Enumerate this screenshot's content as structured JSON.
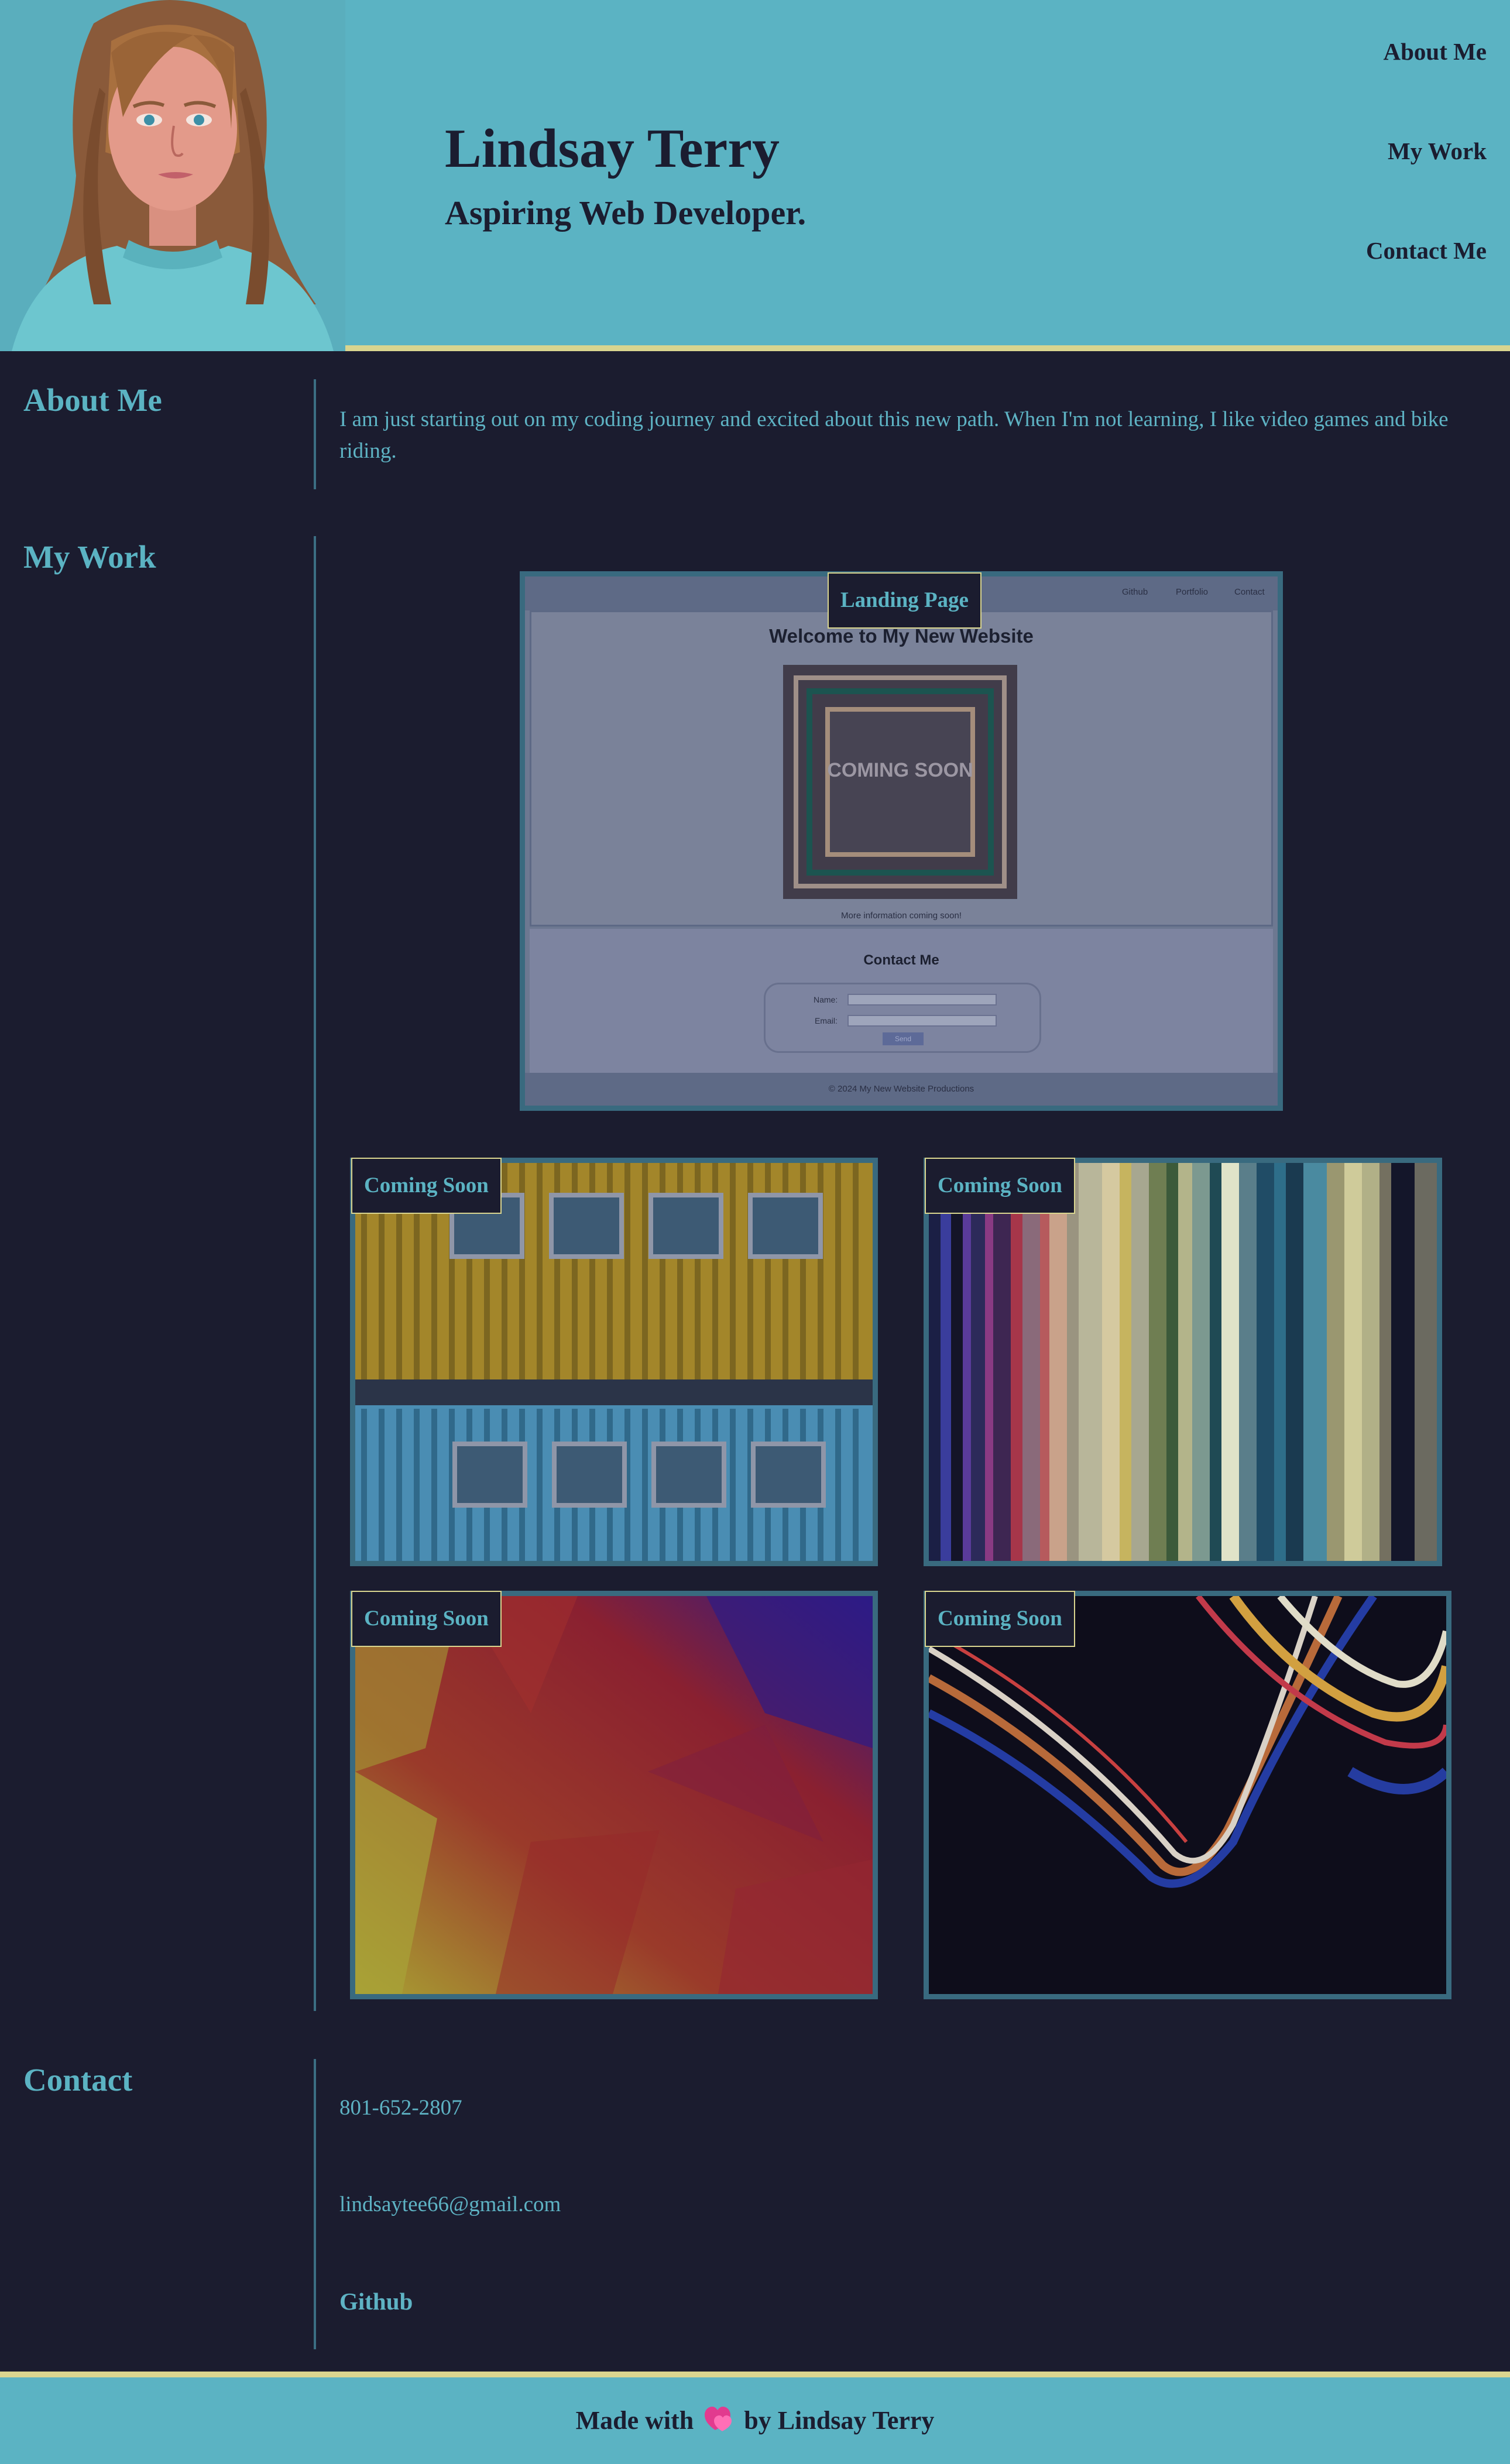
{
  "header": {
    "name": "Lindsay Terry",
    "tagline": "Aspiring Web Developer.",
    "nav": [
      "About Me",
      "My Work",
      "Contact Me"
    ],
    "avatar": "portrait-illustration"
  },
  "about": {
    "title": "About Me",
    "text": "I am just starting out on my coding journey and excited about this new path. When I'm not learning, I like video games and bike riding."
  },
  "work": {
    "title": "My Work",
    "featured": {
      "label": "Landing Page",
      "preview": {
        "nav": [
          "Github",
          "Portfolio",
          "Contact"
        ],
        "heading": "Welcome to My New Website",
        "image_text": "COMING SOON",
        "more_info": "More information coming soon!",
        "contact_title": "Contact Me",
        "name_label": "Name:",
        "email_label": "Email:",
        "send_label": "Send",
        "footer": "© 2024 My New Website Productions"
      }
    },
    "projects": [
      {
        "label": "Coming Soon",
        "image": "shipping-containers-photo"
      },
      {
        "label": "Coming Soon",
        "image": "color-stripes-photo"
      },
      {
        "label": "Coming Soon",
        "image": "low-poly-gradient"
      },
      {
        "label": "Coming Soon",
        "image": "light-trails-photo"
      }
    ]
  },
  "contact": {
    "title": "Contact",
    "phone": "801-652-2807",
    "email": "lindsaytee66@gmail.com",
    "github": "Github"
  },
  "footer": {
    "prefix": "Made with",
    "suffix": "by Lindsay Terry",
    "icon": "heart-icon"
  },
  "colors": {
    "background": "#1b1c2f",
    "header": "#5bb3c3",
    "accent_border": "#d9d58f",
    "text_accent": "#5eb3c4",
    "card_border": "#396a7f"
  }
}
